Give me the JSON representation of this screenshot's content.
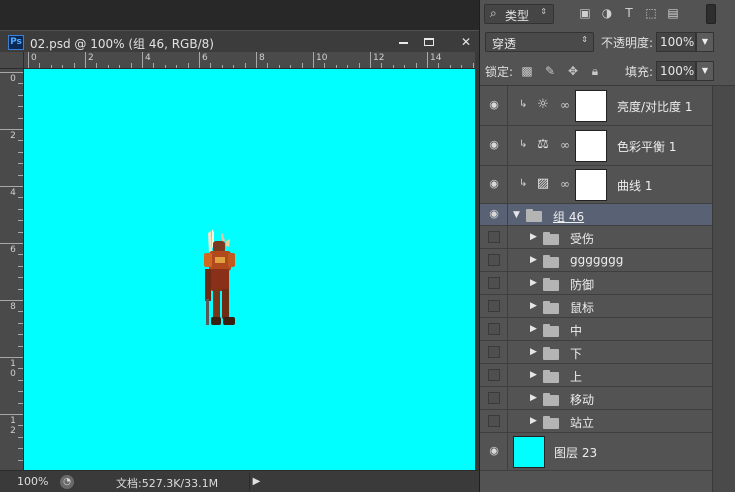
{
  "document": {
    "title": "02.psd @ 100% (组 46, RGB/8)",
    "app_badge": "Ps",
    "window_controls": {
      "minimize": "—",
      "maximize": "□",
      "close": "✕"
    },
    "ruler_top_labels": [
      "0",
      "2",
      "4",
      "6",
      "8",
      "10",
      "12",
      "14"
    ],
    "ruler_left_labels": [
      "0",
      "2",
      "4",
      "6",
      "8",
      "10",
      "12"
    ],
    "canvas_color": "#00ffff",
    "status": {
      "zoom": "100%",
      "doc_size": "文档:527.3K/33.1M",
      "arrow": "▶"
    }
  },
  "layers_panel": {
    "filter": {
      "kind_icon": "⌕",
      "kind_label": "类型",
      "kind_arrow": "⇕",
      "icons": [
        "image-filter-icon",
        "adjustment-filter-icon",
        "type-filter-icon",
        "shape-filter-icon",
        "smart-object-filter-icon"
      ]
    },
    "blend_mode": "穿透",
    "blend_arrow": "⇕",
    "opacity_label": "不透明度:",
    "opacity": "100%",
    "lock_label": "锁定:",
    "fill_label": "填充:",
    "fill": "100%",
    "dropdown_arrow": "▼",
    "adjustment_layers": [
      {
        "name": "亮度/对比度 1",
        "icon": "☼",
        "icon_name": "brightness-contrast-icon"
      },
      {
        "name": "色彩平衡 1",
        "icon": "⚖",
        "icon_name": "color-balance-icon"
      },
      {
        "name": "曲线 1",
        "icon": "▨",
        "icon_name": "curves-icon"
      }
    ],
    "group": {
      "name": "组 46"
    },
    "sub_groups": [
      "受伤",
      "ggggggg",
      "防御",
      "鼠标",
      "中",
      "下",
      "上",
      "移动",
      "站立"
    ],
    "background_layer": {
      "name": "图层 23",
      "thumb_color": "#00ffff"
    },
    "selected_color": "#586274"
  }
}
